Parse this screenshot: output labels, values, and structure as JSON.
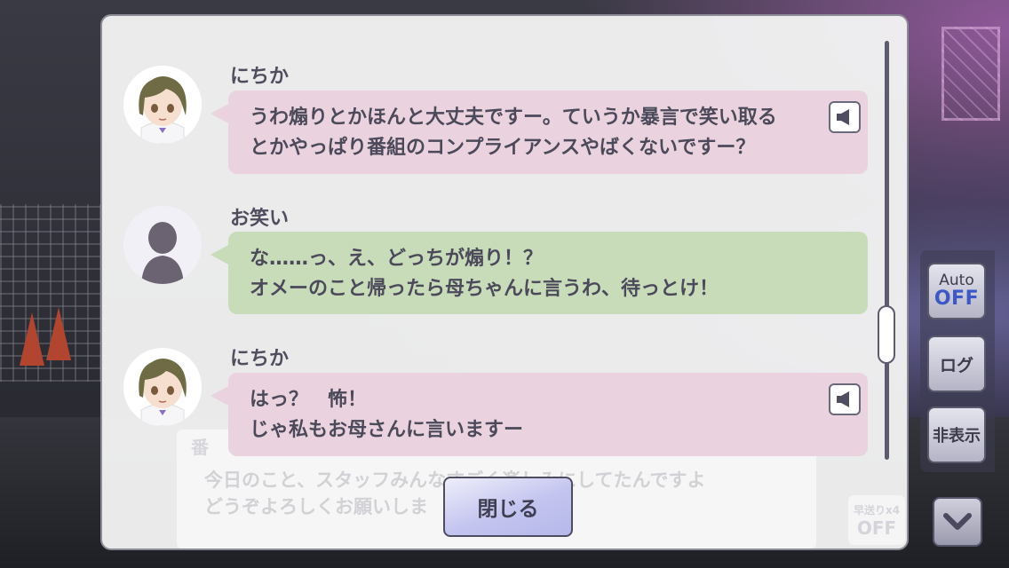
{
  "log": {
    "entries": [
      {
        "speaker": "にちか",
        "line1": "うわ煽りとかほんと大丈夫ですー。ていうか暴言で笑い取る",
        "line2": "とかやっぱり番組のコンプライアンスやばくないですー？",
        "has_voice": true,
        "bubble_color": "#ead3de",
        "avatar": "nichika-avatar"
      },
      {
        "speaker": "お笑い",
        "line1": "な……っ、え、どっちが煽り！？",
        "line2": "オメーのこと帰ったら母ちゃんに言うわ、待っとけ！",
        "has_voice": false,
        "bubble_color": "#c8dcba",
        "avatar": "silhouette-avatar"
      },
      {
        "speaker": "にちか",
        "line1": "はっ？　怖！",
        "line2": "じゃ私もお母さんに言いますー",
        "has_voice": true,
        "bubble_color": "#ead3de",
        "avatar": "nichika-avatar"
      }
    ],
    "close_label": "閉じる"
  },
  "background_message": {
    "speaker": "番",
    "line1": "今日のこと、スタッフみんなすごく楽しみにしてたんですよ",
    "line2": "どうぞよろしくお願いしま",
    "skip_line1": "早送りx4",
    "skip_line2": "OFF"
  },
  "side_controls": {
    "auto_label": "Auto",
    "auto_state": "OFF",
    "log_label": "ログ",
    "hide_label": "非表示"
  },
  "colors": {
    "pink_bubble": "#ead3de",
    "green_bubble": "#c8dcba",
    "accent_blue": "#3b58c6",
    "text": "#4c4a5a"
  }
}
